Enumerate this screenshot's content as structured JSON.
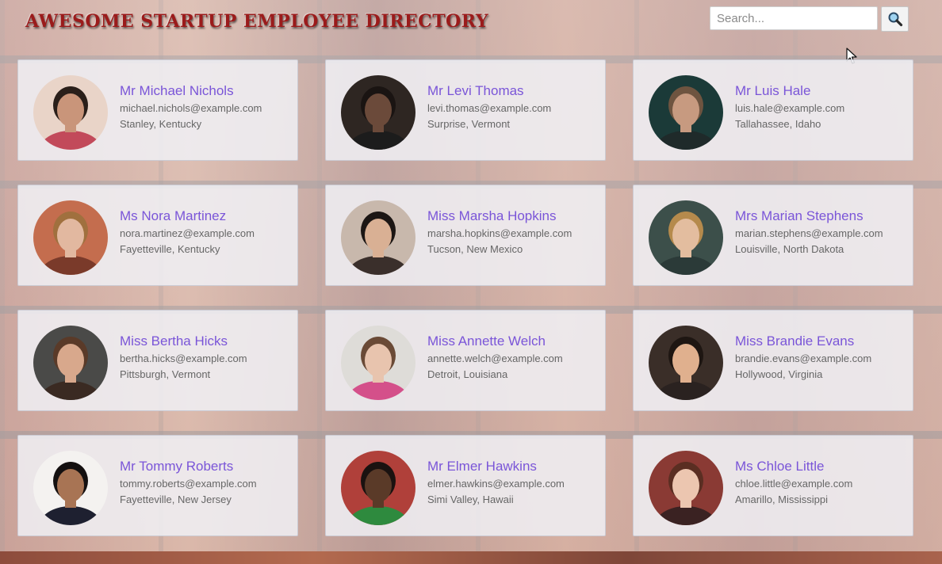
{
  "header": {
    "title": "AWESOME STARTUP EMPLOYEE DIRECTORY"
  },
  "search": {
    "placeholder": "Search...",
    "value": "",
    "button_icon": "search-icon"
  },
  "colors": {
    "title": "#9b1b1b",
    "name": "#7a55d8",
    "detail": "#666666"
  },
  "employees": [
    {
      "name": "Mr Michael Nichols",
      "email": "michael.nichols@example.com",
      "location": "Stanley, Kentucky",
      "skin": "#c9957a",
      "hair": "#2a1f1a",
      "shirt": "#c24a5a",
      "bg": "#e9d4c8"
    },
    {
      "name": "Mr Levi Thomas",
      "email": "levi.thomas@example.com",
      "location": "Surprise, Vermont",
      "skin": "#6b4a3a",
      "hair": "#1a1412",
      "shirt": "#1c1c1c",
      "bg": "#2e2622"
    },
    {
      "name": "Mr Luis Hale",
      "email": "luis.hale@example.com",
      "location": "Tallahassee, Idaho",
      "skin": "#c79a80",
      "hair": "#6e5440",
      "shirt": "#1f2a2a",
      "bg": "#1b3a38"
    },
    {
      "name": "Ms Nora Martinez",
      "email": "nora.martinez@example.com",
      "location": "Fayetteville, Kentucky",
      "skin": "#e2b8a0",
      "hair": "#a0703e",
      "shirt": "#7a3a2a",
      "bg": "#c46d4e"
    },
    {
      "name": "Miss Marsha Hopkins",
      "email": "marsha.hopkins@example.com",
      "location": "Tucson, New Mexico",
      "skin": "#d9b094",
      "hair": "#1c1614",
      "shirt": "#3a2f2b",
      "bg": "#c8b8ac"
    },
    {
      "name": "Mrs Marian Stephens",
      "email": "marian.stephens@example.com",
      "location": "Louisville, North Dakota",
      "skin": "#e3bd9f",
      "hair": "#b58a4c",
      "shirt": "#2b3a38",
      "bg": "#3c4f4a"
    },
    {
      "name": "Miss Bertha Hicks",
      "email": "bertha.hicks@example.com",
      "location": "Pittsburgh, Vermont",
      "skin": "#d8a88c",
      "hair": "#5a3a28",
      "shirt": "#3a2a22",
      "bg": "#4a4a48"
    },
    {
      "name": "Miss Annette Welch",
      "email": "annette.welch@example.com",
      "location": "Detroit, Louisiana",
      "skin": "#e8c4ae",
      "hair": "#6a4a36",
      "shirt": "#d4508a",
      "bg": "#dedcd8"
    },
    {
      "name": "Miss Brandie Evans",
      "email": "brandie.evans@example.com",
      "location": "Hollywood, Virginia",
      "skin": "#e0b08e",
      "hair": "#1e1612",
      "shirt": "#2a2220",
      "bg": "#3a2e28"
    },
    {
      "name": "Mr Tommy Roberts",
      "email": "tommy.roberts@example.com",
      "location": "Fayetteville, New Jersey",
      "skin": "#a87454",
      "hair": "#141010",
      "shirt": "#1e2030",
      "bg": "#f4f2f0"
    },
    {
      "name": "Mr Elmer Hawkins",
      "email": "elmer.hawkins@example.com",
      "location": "Simi Valley, Hawaii",
      "skin": "#5a3a28",
      "hair": "#1a1210",
      "shirt": "#2e8a3e",
      "bg": "#b0403a"
    },
    {
      "name": "Ms Chloe Little",
      "email": "chloe.little@example.com",
      "location": "Amarillo, Mississippi",
      "skin": "#ecc6b0",
      "hair": "#5a2e22",
      "shirt": "#3a2222",
      "bg": "#8a3a34"
    }
  ]
}
